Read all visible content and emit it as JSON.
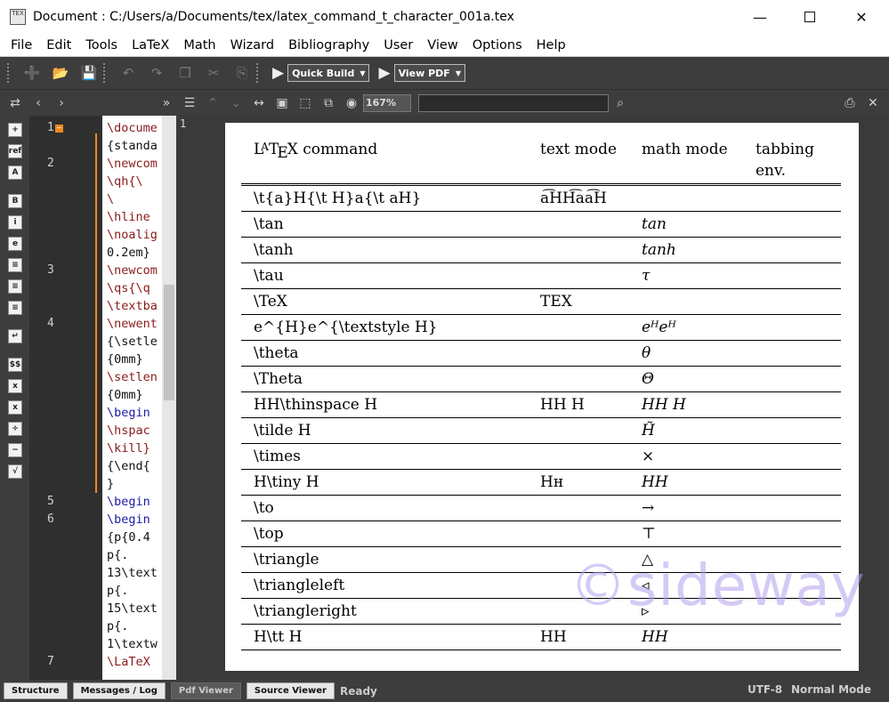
{
  "window": {
    "title": "Document : C:/Users/a/Documents/tex/latex_command_t_character_001a.tex",
    "icon_text": "TEX",
    "minimize_icon": "minimize-icon",
    "maximize_icon": "maximize-icon",
    "close_icon": "close-icon"
  },
  "menu": [
    "File",
    "Edit",
    "Tools",
    "LaTeX",
    "Math",
    "Wizard",
    "Bibliography",
    "User",
    "View",
    "Options",
    "Help"
  ],
  "toolbar": {
    "quick_build": "Quick Build",
    "view_pdf": "View PDF"
  },
  "pdf_toolbar": {
    "zoom": "167%"
  },
  "editor": {
    "line_numbers": [
      "1",
      "2",
      "3",
      "4",
      "5",
      "6",
      "7"
    ],
    "code_lines": [
      "\\docume",
      "{standa",
      "\\newcom",
      "\\qh{\\",
      "\\",
      "\\hline",
      "\\noalig",
      "0.2em}",
      "\\newcom",
      "\\qs{\\q",
      "\\textba",
      "\\newent",
      "{\\setle",
      "{0mm}",
      "\\setlen",
      "{0mm}",
      "\\begin",
      "\\hspac",
      "\\kill}",
      "{\\end{",
      "}",
      "\\begin",
      "\\begin",
      "{p{0.4",
      "p{.",
      "13\\text",
      "p{.",
      "15\\text",
      "p{.",
      "1\\textw",
      "\\LaTeX"
    ]
  },
  "pdf_page_number": "1",
  "table": {
    "headers": [
      "LaTeX command",
      "text mode",
      "math mode",
      "tabbing env."
    ],
    "rows": [
      {
        "cmd": "\\t{a}H{\\t H}a{\\t aH}",
        "text": "a͡HH͡aa͡H",
        "math": ""
      },
      {
        "cmd": "\\tan",
        "text": "",
        "math": "tan"
      },
      {
        "cmd": "\\tanh",
        "text": "",
        "math": "tanh"
      },
      {
        "cmd": "\\tau",
        "text": "",
        "math": "τ"
      },
      {
        "cmd": "\\TeX",
        "text": "TEX",
        "math": ""
      },
      {
        "cmd": "e^{H}e^{\\textstyle H}",
        "text": "",
        "math": "eᴴeᴴ"
      },
      {
        "cmd": "\\theta",
        "text": "",
        "math": "θ"
      },
      {
        "cmd": "\\Theta",
        "text": "",
        "math": "Θ"
      },
      {
        "cmd": "HH\\thinspace H",
        "text": "HH H",
        "math": "HH H"
      },
      {
        "cmd": "\\tilde H",
        "text": "",
        "math": "H̃"
      },
      {
        "cmd": "\\times",
        "text": "",
        "math": "×"
      },
      {
        "cmd": "H\\tiny H",
        "text": "Hʜ",
        "math": "HH"
      },
      {
        "cmd": "\\to",
        "text": "",
        "math": "→"
      },
      {
        "cmd": "\\top",
        "text": "",
        "math": "⊤"
      },
      {
        "cmd": "\\triangle",
        "text": "",
        "math": "△"
      },
      {
        "cmd": "\\triangleleft",
        "text": "",
        "math": "◃"
      },
      {
        "cmd": "\\triangleright",
        "text": "",
        "math": "▹"
      },
      {
        "cmd": "H\\tt H",
        "text": "HH",
        "math": "HH"
      }
    ]
  },
  "watermark": "©sideway",
  "statusbar": {
    "tabs": [
      "Structure",
      "Messages / Log",
      "Pdf Viewer",
      "Source Viewer"
    ],
    "status": "Ready",
    "encoding": "UTF-8",
    "mode": "Normal Mode"
  }
}
